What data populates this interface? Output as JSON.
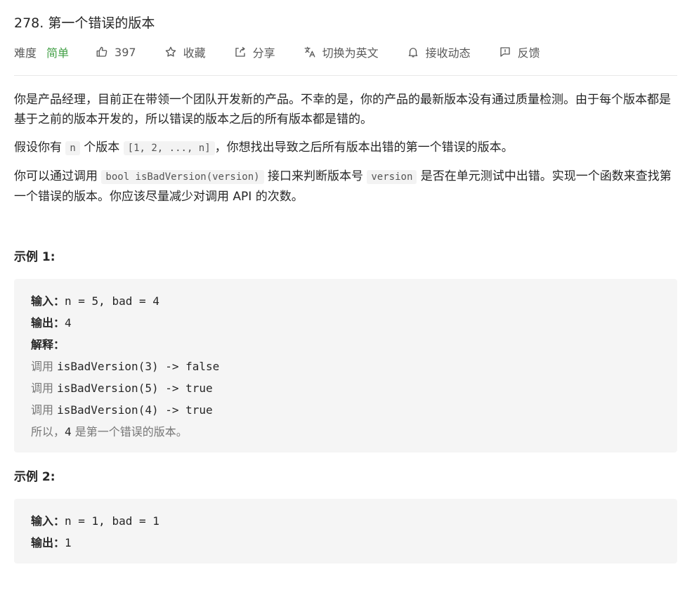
{
  "problem": {
    "number": "278.",
    "title": "第一个错误的版本"
  },
  "meta": {
    "difficulty_label": "难度",
    "difficulty_value": "简单",
    "difficulty_color": "#43a047",
    "likes": "397",
    "favorite_label": "收藏",
    "share_label": "分享",
    "language_label": "切换为英文",
    "subscribe_label": "接收动态",
    "feedback_label": "反馈"
  },
  "description": {
    "p1": "你是产品经理，目前正在带领一个团队开发新的产品。不幸的是，你的产品的最新版本没有通过质量检测。由于每个版本都是基于之前的版本开发的，所以错误的版本之后的所有版本都是错的。",
    "p2_a": "假设你有 ",
    "p2_code1": "n",
    "p2_b": " 个版本 ",
    "p2_code2": "[1, 2, ..., n]",
    "p2_c": "，你想找出导致之后所有版本出错的第一个错误的版本。",
    "p3_a": "你可以通过调用 ",
    "p3_code1": "bool isBadVersion(version)",
    "p3_b": " 接口来判断版本号 ",
    "p3_code2": "version",
    "p3_c": " 是否在单元测试中出错。实现一个函数来查找第一个错误的版本。你应该尽量减少对调用 API 的次数。"
  },
  "examples": [
    {
      "title": "示例 1:",
      "input_label": "输入：",
      "input_value": "n = 5, bad = 4",
      "output_label": "输出：",
      "output_value": "4",
      "explain_label": "解释：",
      "calls": [
        {
          "prefix": "调用 ",
          "code": "isBadVersion(3) -> false"
        },
        {
          "prefix": "调用 ",
          "code": "isBadVersion(5) -> true"
        },
        {
          "prefix": "调用 ",
          "code": "isBadVersion(4) -> true"
        }
      ],
      "conclusion_a": "所以，",
      "conclusion_num": "4",
      "conclusion_b": " 是第一个错误的版本。"
    },
    {
      "title": "示例 2:",
      "input_label": "输入：",
      "input_value": "n = 1, bad = 1",
      "output_label": "输出：",
      "output_value": "1"
    }
  ]
}
